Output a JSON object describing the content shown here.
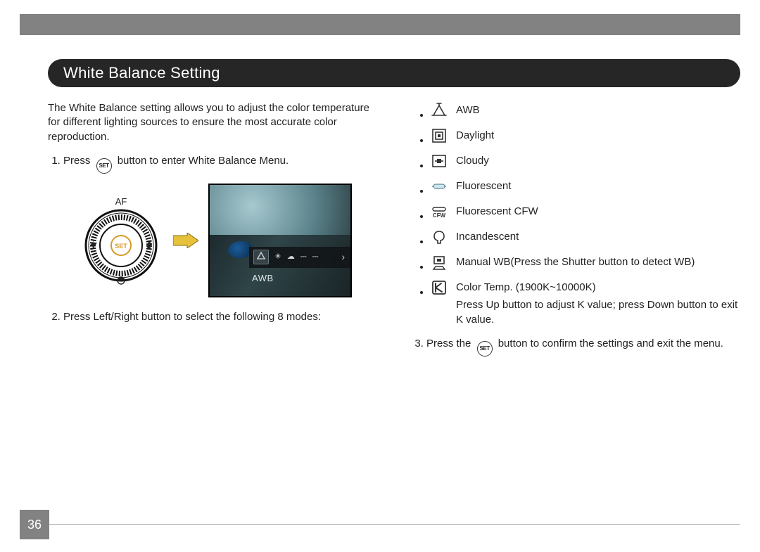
{
  "page_number": "36",
  "heading": "White Balance Setting",
  "intro": "The White Balance setting allows you to adjust the color temperature for different lighting sources to ensure the most accurate color reproduction.",
  "set_button_label": "SET",
  "step1_a": "Press",
  "step1_b": "button to enter White Balance Menu.",
  "step2": "Press Left/Right button to select the following 8 modes:",
  "step3_a": "Press the",
  "step3_b": "button to confirm the settings and exit the menu.",
  "lcd_overlay_label": "AWB",
  "dial_top_label": "AF",
  "modes": [
    {
      "icon": "awb",
      "label": "AWB"
    },
    {
      "icon": "daylight",
      "label": "Daylight"
    },
    {
      "icon": "cloudy",
      "label": "Cloudy"
    },
    {
      "icon": "fluorescent",
      "label": "Fluorescent"
    },
    {
      "icon": "fluorescent-cfw",
      "label": "Fluorescent CFW"
    },
    {
      "icon": "incandescent",
      "label": "Incandescent"
    },
    {
      "icon": "manual-wb",
      "label": "Manual WB(Press the Shutter button to detect WB)"
    },
    {
      "icon": "color-temp",
      "label": "Color Temp. (1900K~10000K)",
      "sub": "Press Up button to adjust K value; press Down button to exit K value."
    }
  ]
}
